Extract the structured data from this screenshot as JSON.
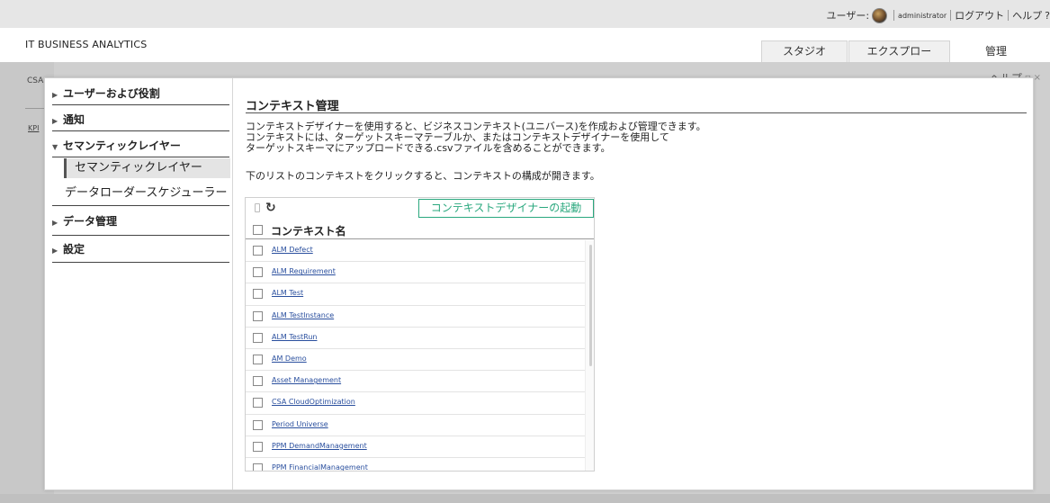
{
  "userbar": {
    "user_label": "ユーザー:",
    "username": "administrator",
    "logout": "ログアウト",
    "help": "ヘルプ",
    "help_q": "?"
  },
  "header": {
    "brand": "IT BUSINESS ANALYTICS",
    "tabs": [
      {
        "label": "スタジオ"
      },
      {
        "label": "エクスプローラー"
      },
      {
        "label": "管理"
      }
    ]
  },
  "background": {
    "label1": "CSA",
    "label2": "KPI"
  },
  "modal": {
    "help": "ヘルプ"
  },
  "sidebar": {
    "sections": [
      {
        "label": "ユーザーおよび役割"
      },
      {
        "label": "通知"
      },
      {
        "label": "セマンティックレイヤー"
      },
      {
        "label": "データ管理"
      },
      {
        "label": "設定"
      }
    ],
    "subitems": [
      {
        "label": "セマンティックレイヤー"
      },
      {
        "label": "データローダースケジューラー"
      }
    ]
  },
  "content": {
    "title": "コンテキスト管理",
    "desc": "コンテキストデザイナーを使用すると、ビジネスコンテキスト(ユニバース)を作成および管理できます。\nコンテキストには、ターゲットスキーマテーブルか、またはコンテキストデザイナーを使用して\nターゲットスキーマにアップロードできる.csvファイルを含めることができます。",
    "desc2": "下のリストのコンテキストをクリックすると、コンテキストの構成が開きます。",
    "launch_button": "コンテキストデザイナーの起動",
    "column_header": "コンテキスト名",
    "contexts": [
      "ALM Defect",
      "ALM Requirement",
      "ALM Test",
      "ALM TestInstance",
      "ALM TestRun",
      "AM Demo",
      "Asset Management",
      "CSA CloudOptimization",
      "Period Universe",
      "PPM DemandManagement",
      "PPM FinancialManagement"
    ]
  }
}
